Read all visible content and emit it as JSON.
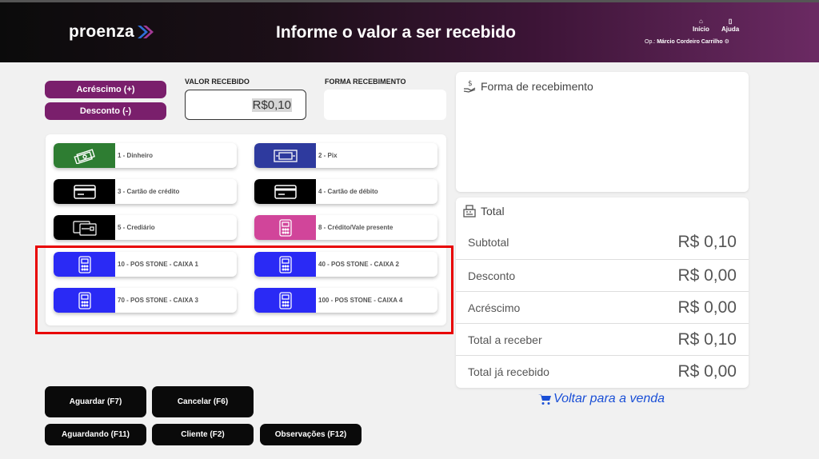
{
  "header": {
    "brand": "proenza",
    "title": "Informe o valor a ser recebido",
    "inicio_label": "Início",
    "ajuda_label": "Ajuda",
    "operator_prefix": "Op.:",
    "operator_name": "Márcio Cordeiro Carrilho"
  },
  "adjust": {
    "acrescimo_label": "Acréscimo (+)",
    "desconto_label": "Desconto (-)"
  },
  "valor": {
    "label": "VALOR RECEBIDO",
    "value": "R$0,10"
  },
  "forma": {
    "label": "FORMA RECEBIMENTO",
    "value": ""
  },
  "methods": [
    {
      "label": "1 - Dinheiro",
      "color": "#2e7d32",
      "icon": "cash-icon"
    },
    {
      "label": "2 - Pix",
      "color": "#2e3a9e",
      "icon": "pix-icon"
    },
    {
      "label": "3 - Cartão de crédito",
      "color": "#000000",
      "icon": "credit-card-icon"
    },
    {
      "label": "4 - Cartão de débito",
      "color": "#000000",
      "icon": "debit-card-icon"
    },
    {
      "label": "5 - Crediário",
      "color": "#000000",
      "icon": "crediario-card-icon"
    },
    {
      "label": "8 - Crédito/Vale presente",
      "color": "#d1459a",
      "icon": "pos-terminal-icon"
    },
    {
      "label": "10 - POS STONE - CAIXA 1",
      "color": "#2a2af5",
      "icon": "pos-terminal-icon"
    },
    {
      "label": "40 - POS STONE - CAIXA 2",
      "color": "#2a2af5",
      "icon": "pos-terminal-icon"
    },
    {
      "label": "70 - POS STONE - CAIXA 3",
      "color": "#2a2af5",
      "icon": "pos-terminal-icon"
    },
    {
      "label": "100 - POS STONE - CAIXA 4",
      "color": "#2a2af5",
      "icon": "pos-terminal-icon"
    }
  ],
  "forma_card": {
    "title": "Forma de recebimento"
  },
  "total_card": {
    "title": "Total",
    "rows": [
      {
        "label": "Subtotal",
        "value": "R$ 0,10"
      },
      {
        "label": "Desconto",
        "value": "R$ 0,00"
      },
      {
        "label": "Acréscimo",
        "value": "R$ 0,00"
      },
      {
        "label": "Total a receber",
        "value": "R$ 0,10"
      },
      {
        "label": "Total já recebido",
        "value": "R$ 0,00"
      }
    ]
  },
  "voltar_label": "Voltar para a venda",
  "buttons": {
    "aguardar": "Aguardar (F7)",
    "cancelar": "Cancelar (F6)",
    "aguardando": "Aguardando (F11)",
    "cliente": "Cliente (F2)",
    "observacoes": "Observações (F12)"
  },
  "colors": {
    "brand_purple": "#7a1f6c",
    "highlight": "#e80000",
    "link_blue": "#1a4fd6"
  }
}
